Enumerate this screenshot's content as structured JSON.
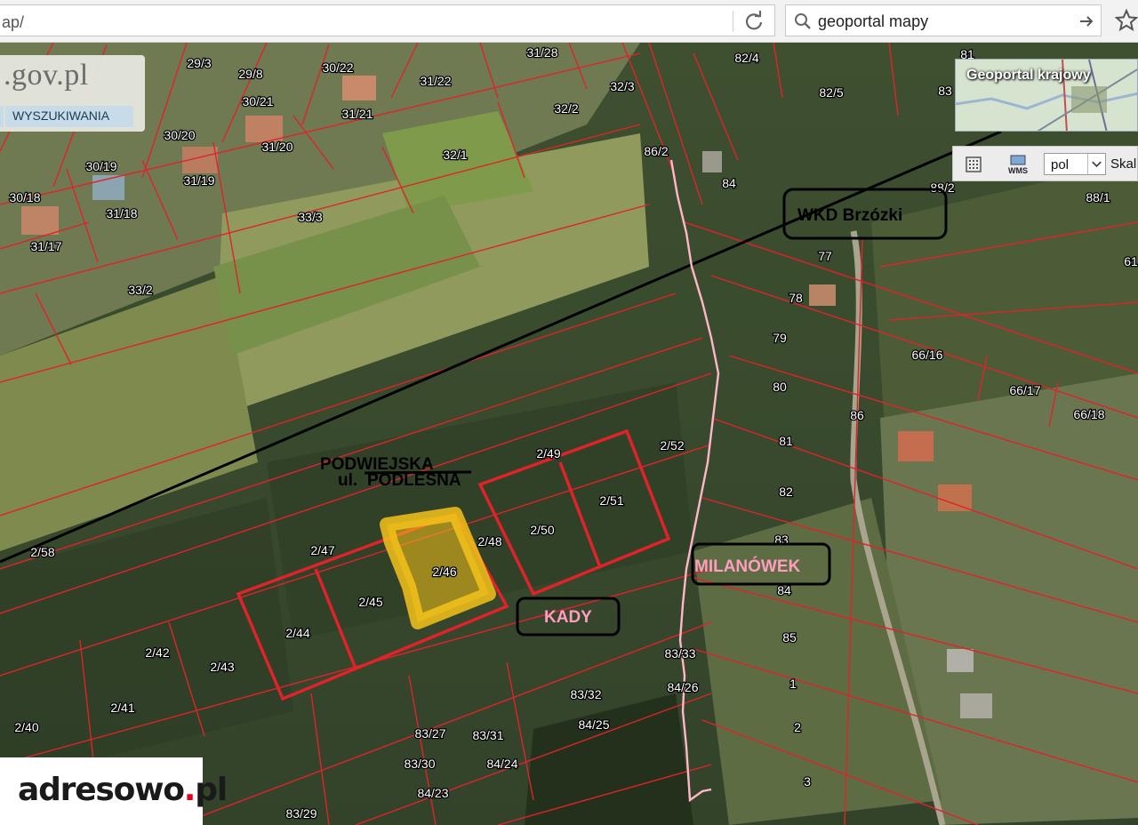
{
  "browser": {
    "url": "ap/",
    "search_query": "geoportal mapy"
  },
  "site_badge": {
    "site_text": ".gov.pl",
    "search_mode_label": "WYSZUKIWANIA"
  },
  "minimap": {
    "title": "Geoportal krajowy"
  },
  "toolbar": {
    "language_value": "pol",
    "scale_label": "Skal"
  },
  "annotations": {
    "station": "WKD Brzózki",
    "street_new": "PODWIEJSKA",
    "street_prefix": "ul.",
    "street_old": "PODLESNA",
    "district_kady": "KADY",
    "district_milanowek": "MILANÓWEK"
  },
  "parcels": [
    {
      "label": "29/3"
    },
    {
      "label": "29/8"
    },
    {
      "label": "30/22"
    },
    {
      "label": "31/28"
    },
    {
      "label": "82/4"
    },
    {
      "label": "81"
    },
    {
      "label": "31/22"
    },
    {
      "label": "32/3"
    },
    {
      "label": "82/5"
    },
    {
      "label": "83"
    },
    {
      "label": "30/21"
    },
    {
      "label": "31/21"
    },
    {
      "label": "32/2"
    },
    {
      "label": "30/20"
    },
    {
      "label": "31/20"
    },
    {
      "label": "32/1"
    },
    {
      "label": "86/2"
    },
    {
      "label": "30/19"
    },
    {
      "label": "31/19"
    },
    {
      "label": "84"
    },
    {
      "label": "30/18"
    },
    {
      "label": "31/18"
    },
    {
      "label": "33/3"
    },
    {
      "label": "88/2"
    },
    {
      "label": "88/1"
    },
    {
      "label": "31/17"
    },
    {
      "label": "77"
    },
    {
      "label": "61"
    },
    {
      "label": "33/2"
    },
    {
      "label": "78"
    },
    {
      "label": "79"
    },
    {
      "label": "66/16"
    },
    {
      "label": "80"
    },
    {
      "label": "66/17"
    },
    {
      "label": "66/18"
    },
    {
      "label": "86"
    },
    {
      "label": "81"
    },
    {
      "label": "2/49"
    },
    {
      "label": "2/52"
    },
    {
      "label": "82"
    },
    {
      "label": "2/51"
    },
    {
      "label": "2/50"
    },
    {
      "label": "83"
    },
    {
      "label": "2/58"
    },
    {
      "label": "2/47"
    },
    {
      "label": "2/48"
    },
    {
      "label": "2/46"
    },
    {
      "label": "84"
    },
    {
      "label": "2/45"
    },
    {
      "label": "2/44"
    },
    {
      "label": "85"
    },
    {
      "label": "2/42"
    },
    {
      "label": "2/43"
    },
    {
      "label": "83/33"
    },
    {
      "label": "1"
    },
    {
      "label": "84/26"
    },
    {
      "label": "2/41"
    },
    {
      "label": "83/32"
    },
    {
      "label": "2/40"
    },
    {
      "label": "84/25"
    },
    {
      "label": "2"
    },
    {
      "label": "83/27"
    },
    {
      "label": "83/31"
    },
    {
      "label": "83/30"
    },
    {
      "label": "84/24"
    },
    {
      "label": "3"
    },
    {
      "label": "84/23"
    },
    {
      "label": "83/29"
    }
  ],
  "watermark": {
    "brand_main": "adresowo",
    "brand_dot": ".",
    "brand_tld": "pl"
  },
  "colors": {
    "parcel_boundary": "#e0232a",
    "highlight_fill": "#f5c21a",
    "boundary_line": "#ffb6c9",
    "district_text": "#ff9cc0"
  }
}
